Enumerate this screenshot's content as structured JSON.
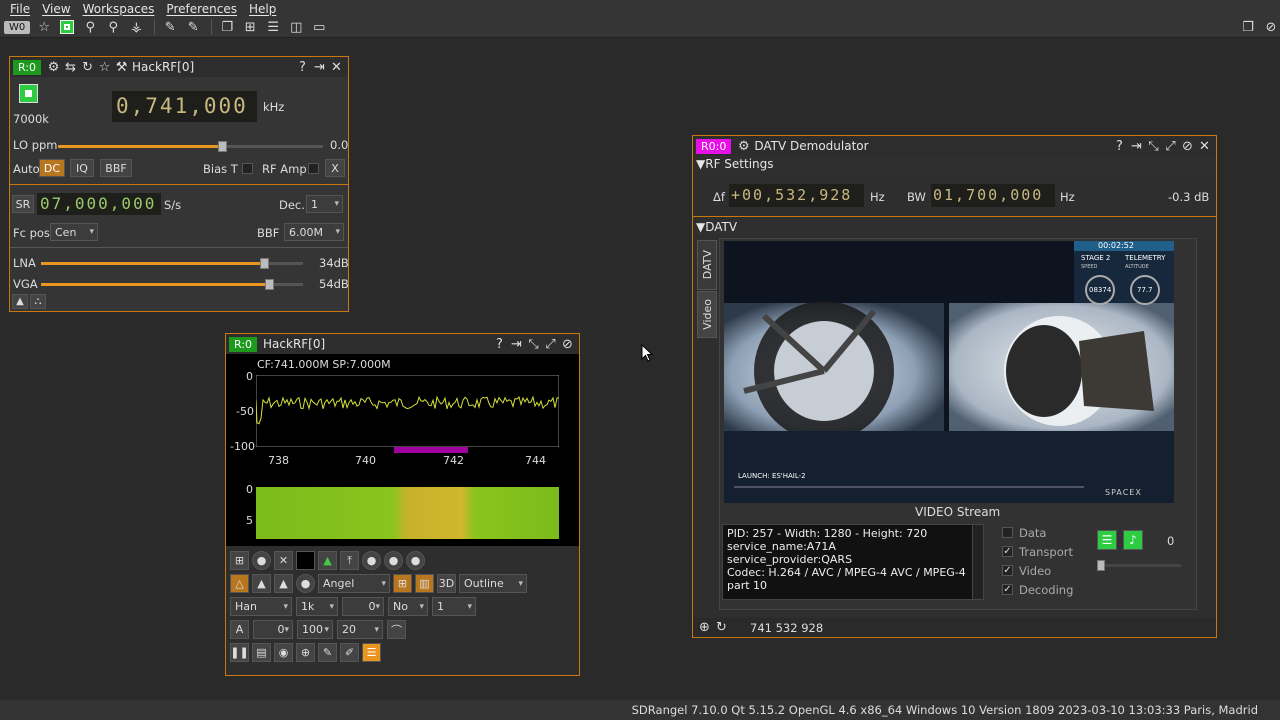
{
  "menu": [
    "File",
    "View",
    "Workspaces",
    "Preferences",
    "Help"
  ],
  "toolbar": {
    "workspace_tag": "W0"
  },
  "hackrf_in": {
    "tag": "R:0",
    "title": "HackRF[0]",
    "freq": "0,741,000",
    "freq_unit": "kHz",
    "sample_label": "7000k",
    "lo_label": "LO ppm",
    "lo_value": "0.0",
    "lo_level": 0.62,
    "auto_label": "Auto",
    "dc_label": "DC",
    "iq_label": "IQ",
    "bbf_btn": "BBF",
    "biast_label": "Bias T",
    "rfamp_label": "RF Amp",
    "x_label": "X",
    "sr_label": "SR",
    "sr_value": "07,000,000",
    "sr_unit": "S/s",
    "dec_label": "Dec.",
    "dec_value": "1",
    "fcpos_label": "Fc pos",
    "fcpos_value": "Cen",
    "bbf_label": "BBF",
    "bbf_value": "6.00M",
    "lna_label": "LNA",
    "lna_value": "34dB",
    "lna_level": 0.85,
    "vga_label": "VGA",
    "vga_value": "54dB",
    "vga_level": 0.87
  },
  "spectrum": {
    "tag": "R:0",
    "title": "HackRF[0]",
    "cf_label": "CF:741.000M SP:7.000M",
    "y_ticks": [
      "0",
      "-50",
      "-100"
    ],
    "x_ticks": [
      "738",
      "740",
      "742",
      "744"
    ],
    "wf_ticks": [
      "0",
      "5"
    ],
    "palette": "Angel",
    "mode": "Outline",
    "window": "Han",
    "fft": "1k",
    "fft_overlap": "0",
    "avg_mode": "No",
    "avg": "1",
    "a_label": "A",
    "ref": "0",
    "range": "100",
    "rate": "20"
  },
  "datv": {
    "tag": "R0:0",
    "title": "DATV Demodulator",
    "rf_section": "RF Settings",
    "df_label": "Δf",
    "df_value": "+00,532,928",
    "df_unit": "Hz",
    "bw_label": "BW",
    "bw_value": "01,700,000",
    "bw_unit": "Hz",
    "power": "-0.3 dB",
    "datv_section": "DATV",
    "side_tabs": [
      "DATV",
      "Video"
    ],
    "stream_label": "VIDEO Stream",
    "info_lines": [
      "PID: 257 - Width: 1280 - Height: 720",
      "service_name:A71A",
      "service_provider:QARS",
      "Codec: H.264 / AVC / MPEG-4 AVC / MPEG-4",
      "part 10"
    ],
    "flags": [
      {
        "label": "Data",
        "checked": false
      },
      {
        "label": "Transport",
        "checked": true
      },
      {
        "label": "Video",
        "checked": true
      },
      {
        "label": "Decoding",
        "checked": true
      }
    ],
    "audio_value": "0",
    "freq_readout": "741 532 928",
    "video_overlay": {
      "timer": "00:02:52",
      "stage": "STAGE 2",
      "telemetry": "TELEMETRY",
      "speed_label": "SPEED",
      "alt_label": "ALTITUDE",
      "speed": "08374",
      "alt": "77.7",
      "launch": "LAUNCH: ES'HAIL-2",
      "brand": "SPACEX"
    }
  },
  "status": "SDRangel 7.10.0 Qt 5.15.2 OpenGL 4.6 x86_64 Windows 10 Version 1809  2023-03-10 13:03:33 Paris, Madrid"
}
